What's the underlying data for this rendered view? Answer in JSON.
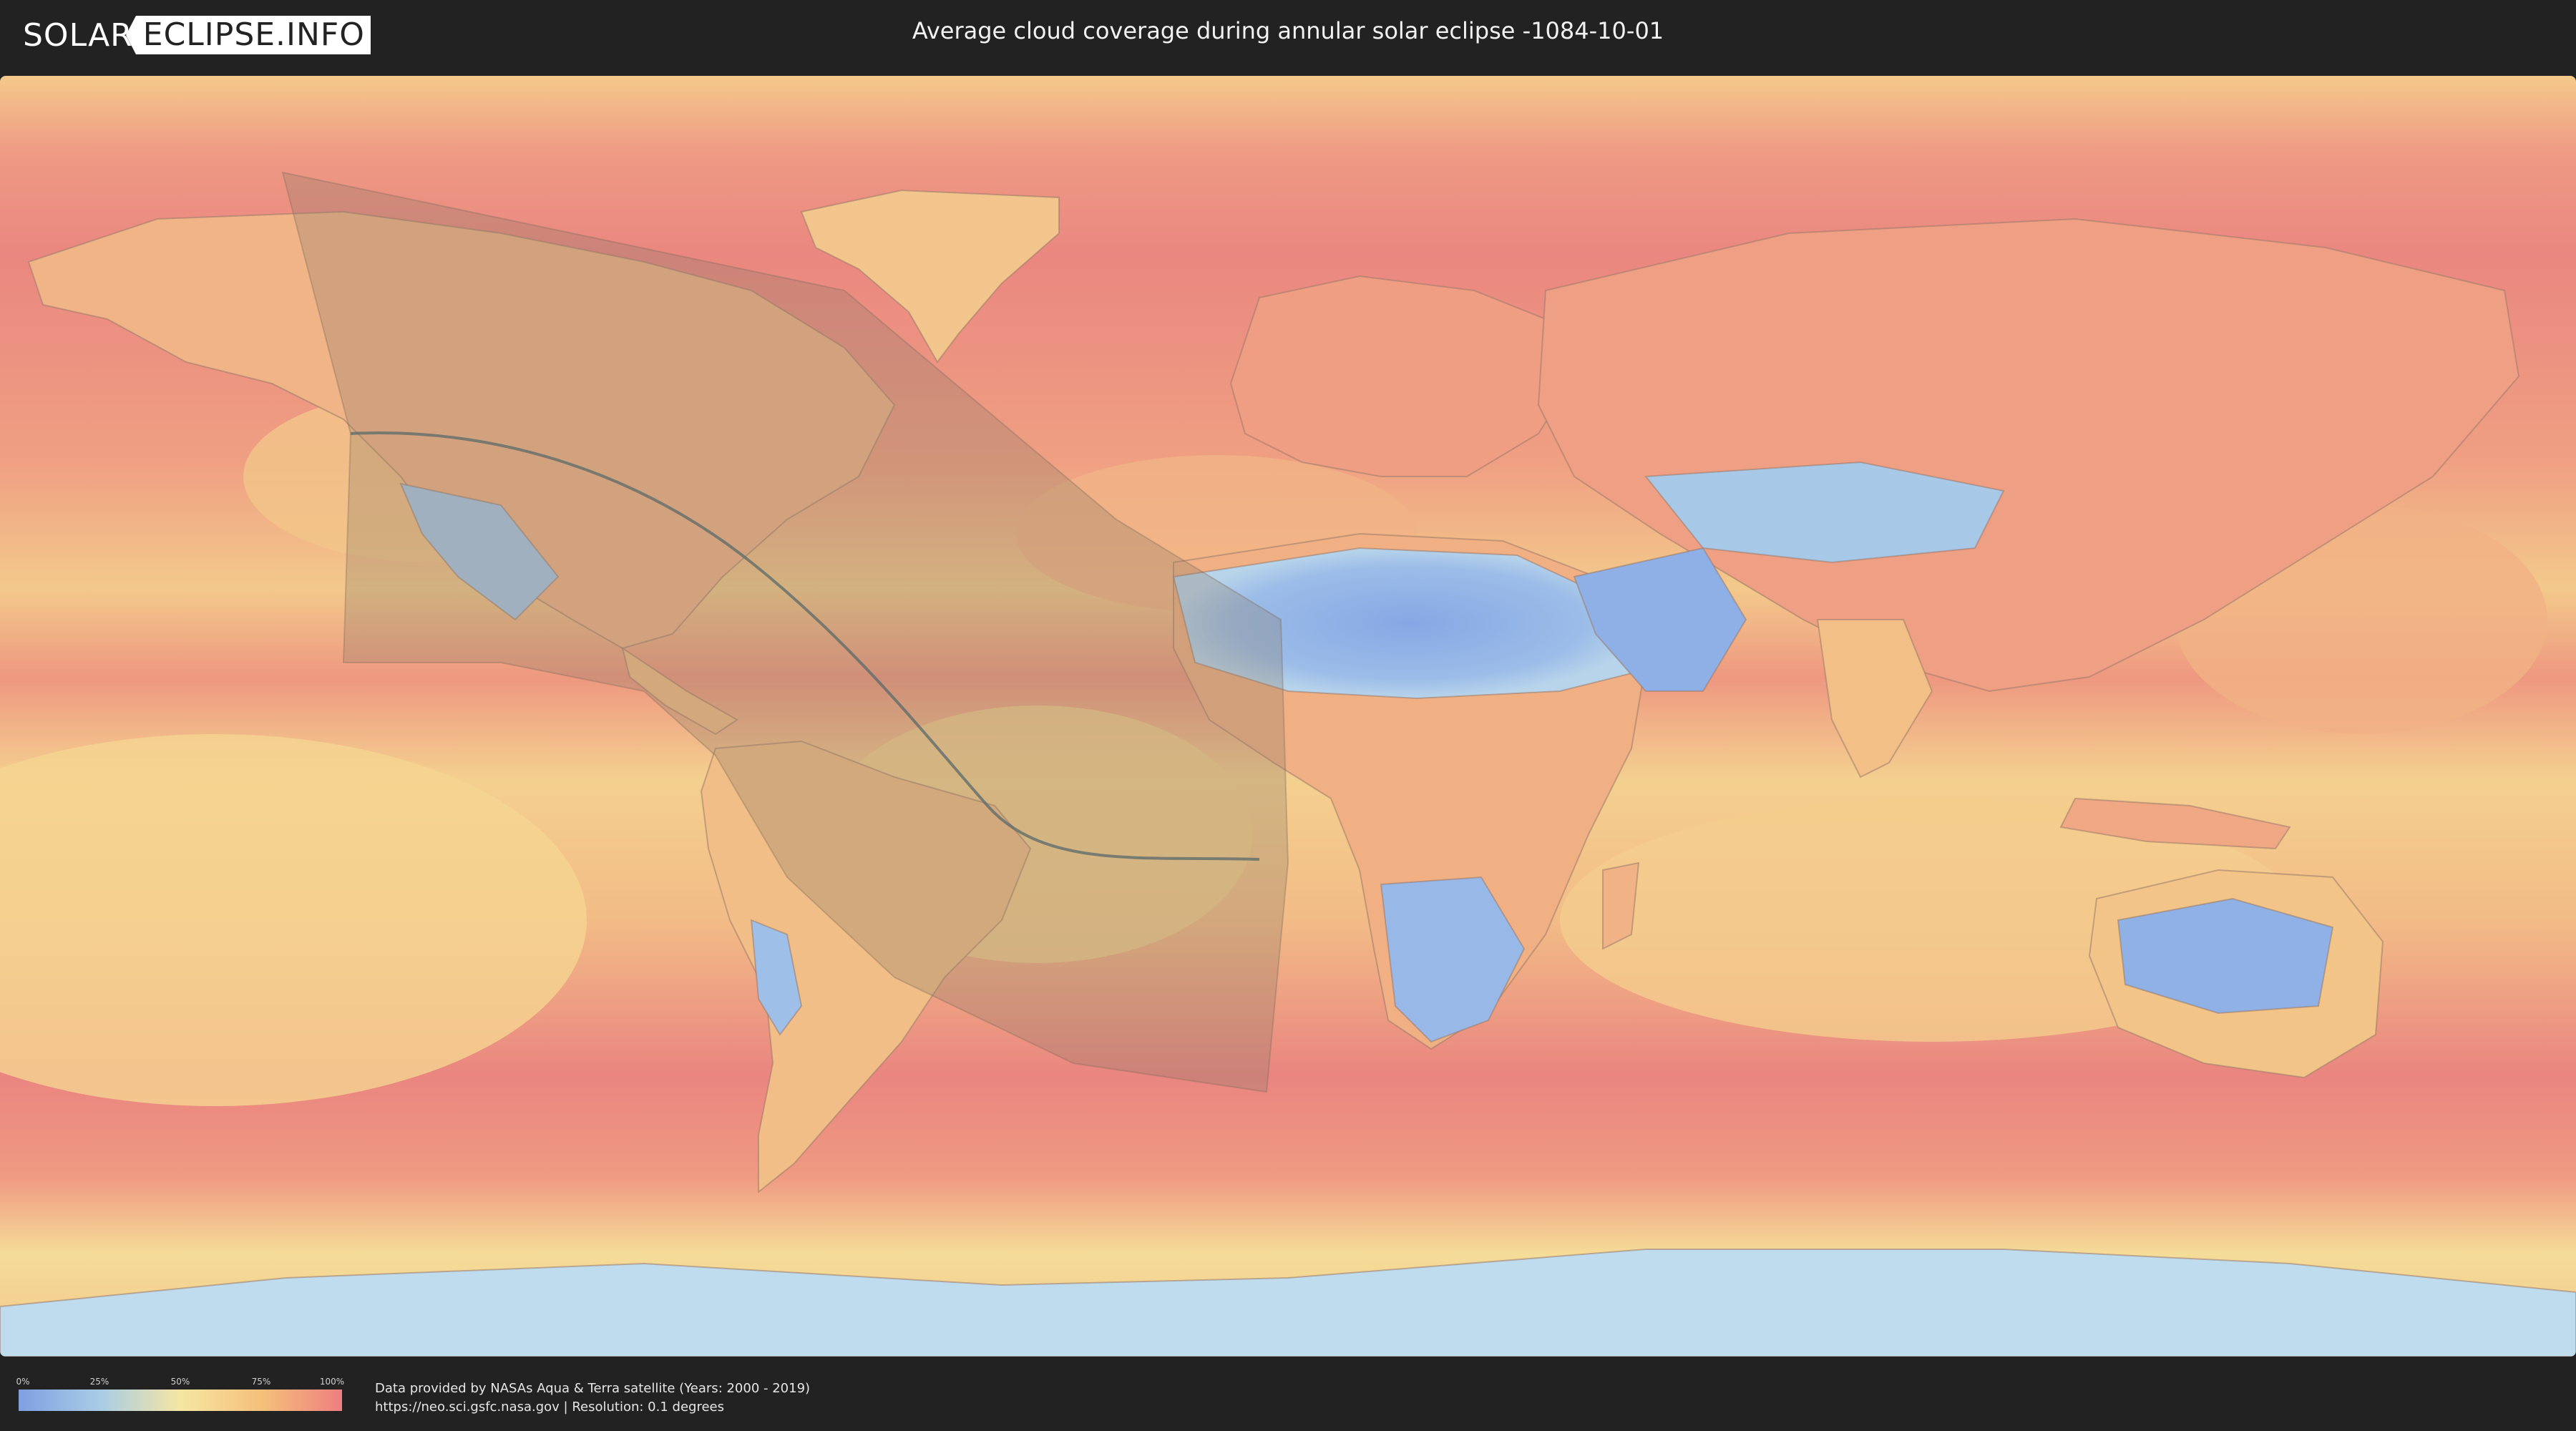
{
  "header": {
    "logo_left": "SOLAR",
    "logo_right": "ECLIPSE.INFO",
    "title": "Average cloud coverage during annular solar eclipse -1084-10-01"
  },
  "legend": {
    "ticks": [
      "0%",
      "25%",
      "50%",
      "75%",
      "100%"
    ],
    "colors": [
      "#7f9fe0",
      "#a8cce6",
      "#f5e6a3",
      "#f5c07a",
      "#ee7f80"
    ]
  },
  "footer": {
    "credit_line1": "Data provided by NASAs Aqua & Terra satellite (Years: 2000 - 2019)",
    "credit_line2": "https://neo.sci.gsfc.nasa.gov | Resolution: 0.1 degrees"
  },
  "map": {
    "eclipse_type": "annular",
    "colors": {
      "ocean_cloudy": "#ea8a82",
      "ocean_mid": "#f2c086",
      "dry_land": "#8fb2e6",
      "ice": "#bcdcef",
      "coast": "#9a7a6a",
      "path_shadow": "#8a7a66",
      "central_line": "#5a6a6a"
    }
  }
}
